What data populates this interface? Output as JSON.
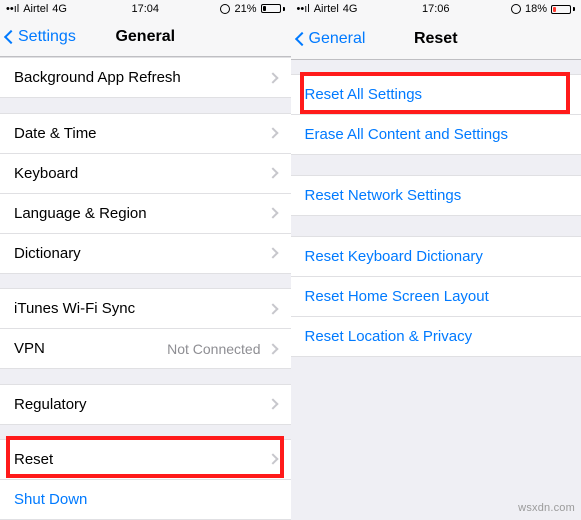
{
  "left": {
    "status": {
      "carrier": "Airtel",
      "network": "4G",
      "time": "17:04",
      "battery_pct": "21%",
      "battery_fill": 21,
      "battery_low": false
    },
    "nav": {
      "back": "Settings",
      "title": "General"
    },
    "cells": {
      "background_app_refresh": "Background App Refresh",
      "date_time": "Date & Time",
      "keyboard": "Keyboard",
      "language_region": "Language & Region",
      "dictionary": "Dictionary",
      "itunes_wifi_sync": "iTunes Wi-Fi Sync",
      "vpn": "VPN",
      "vpn_status": "Not Connected",
      "regulatory": "Regulatory",
      "reset": "Reset",
      "shut_down": "Shut Down"
    }
  },
  "right": {
    "status": {
      "carrier": "Airtel",
      "network": "4G",
      "time": "17:06",
      "battery_pct": "18%",
      "battery_fill": 18,
      "battery_low": true
    },
    "nav": {
      "back": "General",
      "title": "Reset"
    },
    "cells": {
      "reset_all_settings": "Reset All Settings",
      "erase_all_content": "Erase All Content and Settings",
      "reset_network": "Reset Network Settings",
      "reset_keyboard_dict": "Reset Keyboard Dictionary",
      "reset_home_screen": "Reset Home Screen Layout",
      "reset_location_privacy": "Reset Location & Privacy"
    }
  },
  "watermark": "wsxdn.com"
}
